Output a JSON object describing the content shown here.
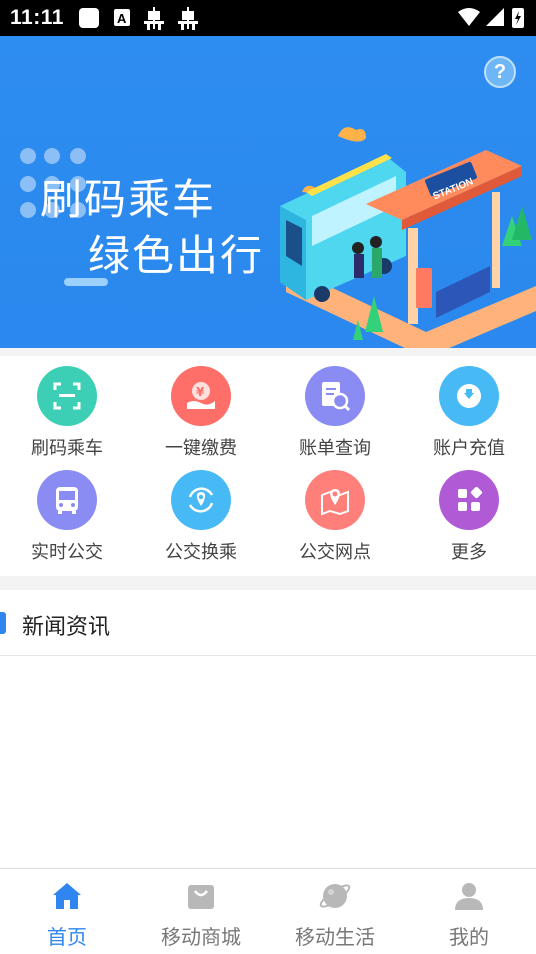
{
  "status_bar": {
    "time": "11:11",
    "icons": [
      "notification-square-icon",
      "a-letter-icon",
      "bug-icon",
      "bug-icon",
      "wifi-icon",
      "cell-signal-icon",
      "battery-charging-icon"
    ]
  },
  "banner": {
    "line1": "刷码乘车",
    "line2": "绿色出行",
    "station_sign": "STATION",
    "help_label": "?"
  },
  "grid": {
    "items": [
      {
        "label": "刷码乘车",
        "icon": "scan-code-icon",
        "color": "#3ccfb5"
      },
      {
        "label": "一键缴费",
        "icon": "yuan-pay-icon",
        "color": "#ff6f6a"
      },
      {
        "label": "账单查询",
        "icon": "bill-search-icon",
        "color": "#8b8cf3"
      },
      {
        "label": "账户充值",
        "icon": "recharge-icon",
        "color": "#47b9f5"
      },
      {
        "label": "实时公交",
        "icon": "bus-icon",
        "color": "#8b8cf3"
      },
      {
        "label": "公交换乘",
        "icon": "transfer-location-icon",
        "color": "#47b9f5"
      },
      {
        "label": "公交网点",
        "icon": "map-pin-icon",
        "color": "#ff7f7a"
      },
      {
        "label": "更多",
        "icon": "more-grid-icon",
        "color": "#b05ad6"
      }
    ]
  },
  "news": {
    "title": "新闻资讯"
  },
  "tabbar": {
    "tabs": [
      {
        "label": "首页",
        "icon": "home-icon",
        "active": true
      },
      {
        "label": "移动商城",
        "icon": "shopping-bag-icon",
        "active": false
      },
      {
        "label": "移动生活",
        "icon": "planet-icon",
        "active": false
      },
      {
        "label": "我的",
        "icon": "user-icon",
        "active": false
      }
    ]
  },
  "colors": {
    "accent": "#2f86f0",
    "banner_bg": "#2e8df0"
  }
}
